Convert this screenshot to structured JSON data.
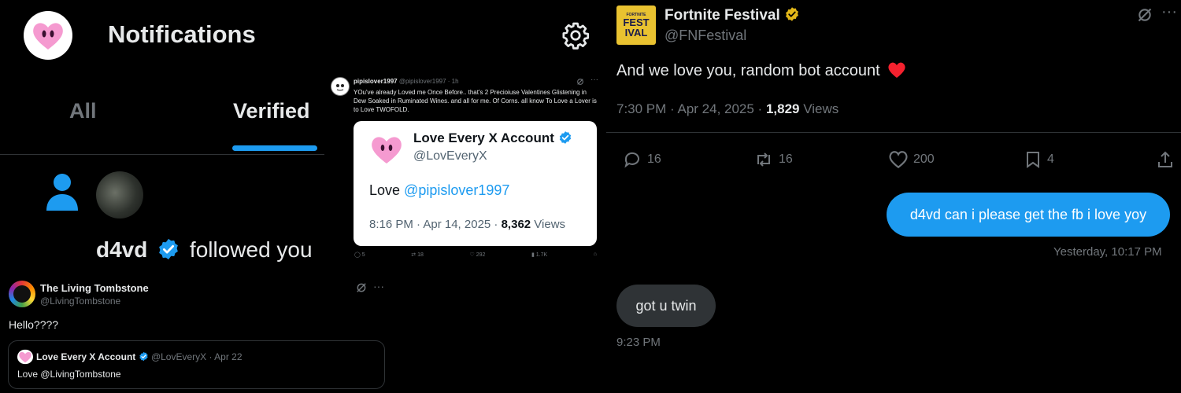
{
  "notifications": {
    "title": "Notifications",
    "tabs": [
      "All",
      "Verified"
    ],
    "follow": {
      "name": "d4vd",
      "text": "followed you"
    }
  },
  "pipis_tweet": {
    "name": "pipislover1997",
    "meta": "@pipislover1997 · 1h",
    "body": "YOu've already Loved me Once Before.. that's 2 Precioiuse Valentines Glistening in Dew  Soaked in Ruminated Wines. and all for me. Of Corns. all know To Love a Lover is to Love TWOFOLD.",
    "stats": {
      "replies": "5",
      "reposts": "18",
      "likes": "292",
      "views": "1.7K"
    }
  },
  "embedded_card": {
    "name": "Love Every X Account",
    "handle": "@LovEveryX",
    "text_prefix": "Love ",
    "mention": "@pipislover1997",
    "time": "8:16 PM · Apr 14, 2025 · ",
    "views_count": "8,362",
    "views_label": " Views"
  },
  "fn_tweet": {
    "name": "Fortnite Festival",
    "handle": "@FNFestival",
    "logo_text": [
      "FORTNITE",
      "FEST",
      "IVAL"
    ],
    "text": "And we love you, random bot account",
    "time": "7:30 PM · Apr 24, 2025 · ",
    "views_count": "1,829",
    "views_label": " Views",
    "stats": {
      "replies": "16",
      "reposts": "16",
      "likes": "200",
      "bookmarks": "4"
    }
  },
  "dm": {
    "sent": "d4vd can i please get the fb i love yoy",
    "sent_time": "Yesterday, 10:17 PM",
    "received": "got u twin",
    "received_time": "9:23 PM"
  },
  "lt_tweet": {
    "name": "The Living Tombstone",
    "handle": "@LivingTombstone",
    "text": "Hello????",
    "quote": {
      "name": "Love Every X Account",
      "meta": "@LovEveryX · Apr 22",
      "text": "Love @LivingTombstone"
    }
  },
  "colors": {
    "accent": "#1d9bf0",
    "verified_gold": "#e2b719",
    "heart_red": "#f4212e",
    "bubble_gray": "#2f3336"
  }
}
